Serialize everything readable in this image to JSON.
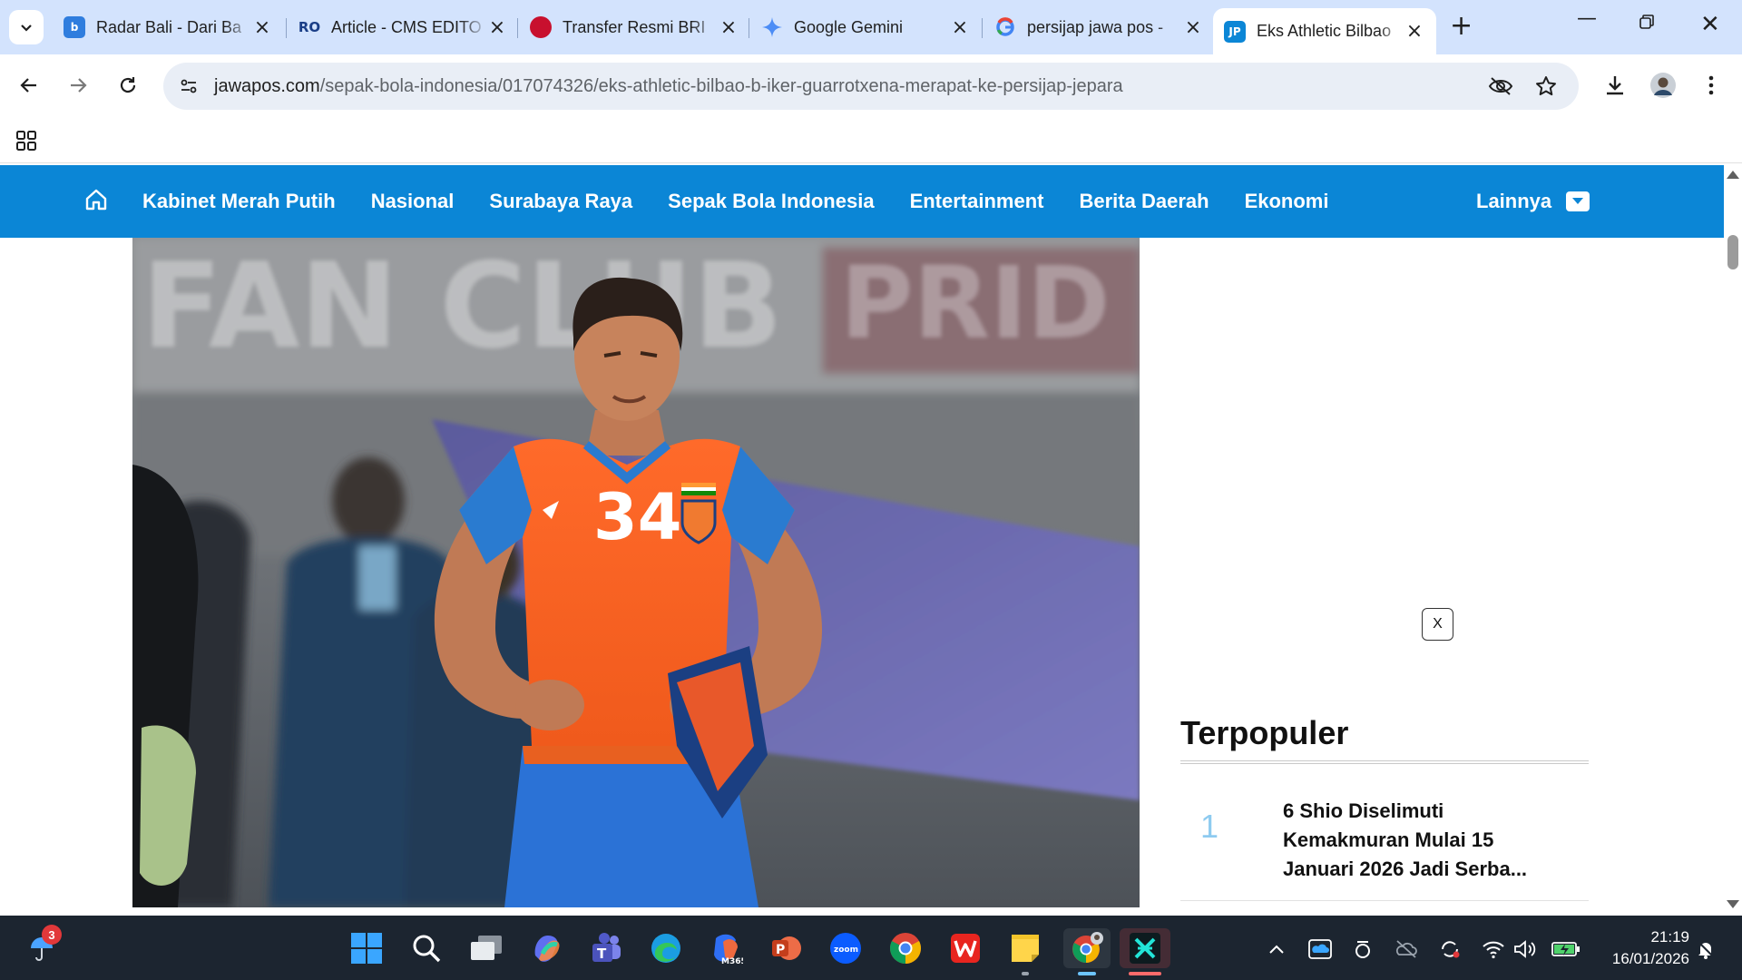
{
  "browser": {
    "tabs": [
      {
        "title": "Radar Bali - Dari Ba",
        "favicon": "radar-bali-icon",
        "color": "#2f7dde"
      },
      {
        "title": "Article - CMS EDITO",
        "favicon": "cms-editor-icon",
        "color": "#1a3e87"
      },
      {
        "title": "Transfer Resmi BRI",
        "favicon": "bri-liga-icon",
        "color": "#c8102e"
      },
      {
        "title": "Google Gemini",
        "favicon": "gemini-icon",
        "color": "#4c8df6"
      },
      {
        "title": "persijap jawa pos -",
        "favicon": "google-icon",
        "color": "#4285f4"
      },
      {
        "title": "Eks Athletic Bilbao",
        "favicon": "jawapos-icon",
        "color": "#0b86d6",
        "active": true
      }
    ],
    "jp_favicon_text": "JP",
    "url_host": "jawapos.com",
    "url_path": "/sepak-bola-indonesia/017074326/eks-athletic-bilbao-b-iker-guarrotxena-merapat-ke-persijap-jepara"
  },
  "site": {
    "nav": [
      "Kabinet Merah Putih",
      "Nasional",
      "Surabaya Raya",
      "Sepak Bola Indonesia",
      "Entertainment",
      "Berita Daerah",
      "Ekonomi"
    ],
    "more_label": "Lainnya",
    "brand_color": "#0b86d6",
    "ad_close_label": "X",
    "popular_heading": "Terpopuler",
    "popular": [
      {
        "rank": "1",
        "title": "6 Shio Diselimuti Kemakmuran Mulai 15 Januari 2026 Jadi Serba..."
      }
    ],
    "hero": {
      "jersey_number": "34",
      "banner_text": "FAN CLUB",
      "banner_text_2": "PRID"
    }
  },
  "taskbar": {
    "weather_badge": "3",
    "time": "21:19",
    "date": "16/01/2026"
  }
}
